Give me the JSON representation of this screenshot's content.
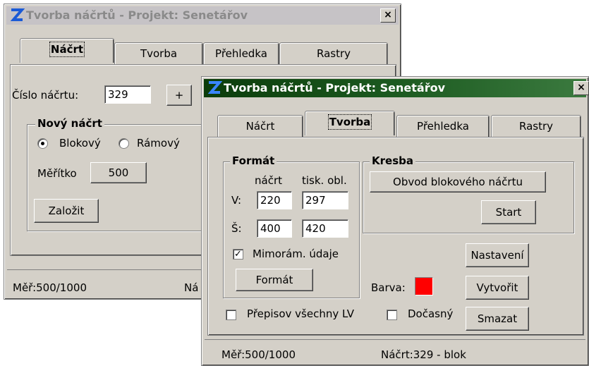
{
  "back_window": {
    "title": "Tvorba náčrtů - Projekt: Senetářov",
    "close_label": "×",
    "tabs": [
      "Náčrt",
      "Tvorba",
      "Přehledka",
      "Rastry"
    ],
    "cislo_label": "Číslo náčrtu:",
    "cislo_value": "329",
    "plus_label": "+",
    "group_title": "Nový náčrt",
    "radio_blokovy": "Blokový",
    "radio_ramovy": "Rámový",
    "meritko_label": "Měřítko",
    "meritko_value": "500",
    "zalozit_label": "Založit",
    "status_left": "Měř:500/1000",
    "status_right": "Ná"
  },
  "front_window": {
    "title": "Tvorba náčrtů - Projekt: Senetářov",
    "close_label": "×",
    "tabs": [
      "Náčrt",
      "Tvorba",
      "Přehledka",
      "Rastry"
    ],
    "format_group": "Formát",
    "col_nacrt": "náčrt",
    "col_tisk": "tisk. obl.",
    "row_v": "V:",
    "row_s": "Š:",
    "v_nacrt": "220",
    "v_tisk": "297",
    "s_nacrt": "400",
    "s_tisk": "420",
    "mimoram_label": "Mimorám. údaje",
    "format_btn": "Formát",
    "kresba_group": "Kresba",
    "obvod_btn": "Obvod blokového náčrtu",
    "start_btn": "Start",
    "nastaveni_btn": "Nastavení",
    "barva_label": "Barva:",
    "barva_color": "#ff0000",
    "vytvorit_btn": "Vytvořit",
    "smazat_btn": "Smazat",
    "prepisov_label": "Přepisov všechny LV",
    "docasny_label": "Dočasný",
    "status_left": "Měř:500/1000",
    "status_right": "Náčrt:329 - blok"
  }
}
